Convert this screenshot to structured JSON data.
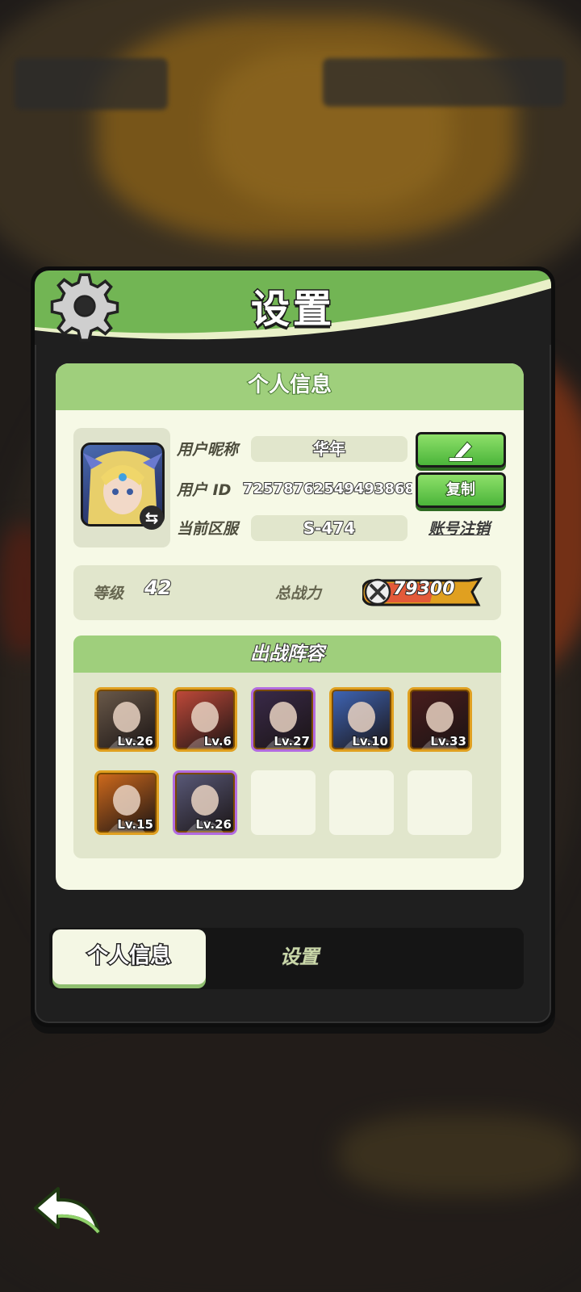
{
  "dialog": {
    "title": "设置"
  },
  "panel": {
    "header": "个人信息"
  },
  "profile": {
    "nickname_label": "用户昵称",
    "nickname": "华年",
    "id_label": "用户  ID",
    "user_id": "7257876254949386​8",
    "server_label": "当前区服",
    "server": "S-474",
    "copy_button": "复制",
    "logout_link": "账号注销"
  },
  "stats": {
    "level_label": "等级",
    "level": "42",
    "power_label": "总战力",
    "power": "79300"
  },
  "lineup": {
    "header": "出战阵容",
    "heroes": [
      {
        "level": "Lv.26",
        "rarity": "orange",
        "color": "#6b5a4a"
      },
      {
        "level": "Lv.6",
        "rarity": "orange",
        "color": "#c24a3a"
      },
      {
        "level": "Lv.27",
        "rarity": "purple",
        "color": "#3a2a4a"
      },
      {
        "level": "Lv.10",
        "rarity": "orange",
        "color": "#3f66b8"
      },
      {
        "level": "Lv.33",
        "rarity": "orange",
        "color": "#4a1d1d"
      },
      {
        "level": "Lv.15",
        "rarity": "orange",
        "color": "#d26b1c"
      },
      {
        "level": "Lv.26",
        "rarity": "purple",
        "color": "#5a5a7a"
      }
    ]
  },
  "tabs": {
    "active": "个人信息",
    "inactive": "设置"
  },
  "colors": {
    "accent_green": "#9fcf7c",
    "button_green": "#4bb53a",
    "panel_bg": "#f6f9e6"
  }
}
